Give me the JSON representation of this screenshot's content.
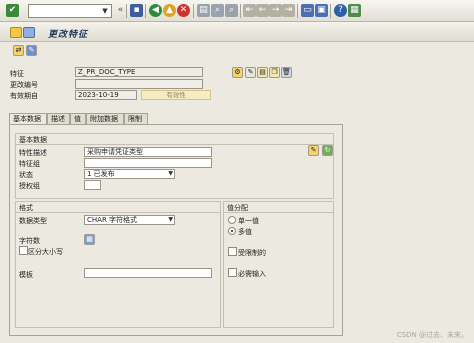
{
  "title": "更改特征",
  "colors": {
    "accent": "#23395d",
    "tab_bg": "#ece9e0",
    "button_disabled_bg": "#f7ecc0"
  },
  "toolbar": {
    "check_icon": "checkmark-icon",
    "command_field_value": "",
    "icons": [
      "back-icon",
      "save-icon",
      "exit-icon",
      "cancel-icon",
      "print-icon",
      "find-icon",
      "find-next-icon",
      "first-page-icon",
      "prev-page-icon",
      "next-page-icon",
      "last-page-icon",
      "new-session-icon",
      "shortcut-icon",
      "help-icon",
      "customize-icon"
    ]
  },
  "header": {
    "characteristic_label": "特征",
    "characteristic_value": "Z_PR_DOC_TYPE",
    "change_no_label": "更改编号",
    "change_no_value": "",
    "valid_from_label": "有效期自",
    "valid_from_value": "2023-10-19",
    "validity_button": "有效性"
  },
  "tabs": [
    {
      "label": "基本数据",
      "active": true
    },
    {
      "label": "描述",
      "active": false
    },
    {
      "label": "值",
      "active": false
    },
    {
      "label": "附加数据",
      "active": false
    },
    {
      "label": "限制",
      "active": false
    }
  ],
  "basic_data": {
    "group_title": "基本数据",
    "description_label": "特性描述",
    "description_value": "采购申请凭证类型",
    "char_group_label": "特征组",
    "char_group_value": "",
    "status_label": "状态",
    "status_value": "1 已发布",
    "auth_group_label": "授权组",
    "auth_group_value": ""
  },
  "format": {
    "group_title": "格式",
    "data_type_label": "数据类型",
    "data_type_value": "CHAR 字符格式",
    "char_count_label": "字符数",
    "case_sensitive_label": "区分大小写",
    "template_label": "模板",
    "template_value": ""
  },
  "value_assignment": {
    "group_title": "值分配",
    "single_value_label": "单一值",
    "multiple_value_label": "多值",
    "multiple_selected": true,
    "restricted_label": "受限制的",
    "required_label": "必需输入"
  },
  "watermark": "CSDN @过去、未来。"
}
